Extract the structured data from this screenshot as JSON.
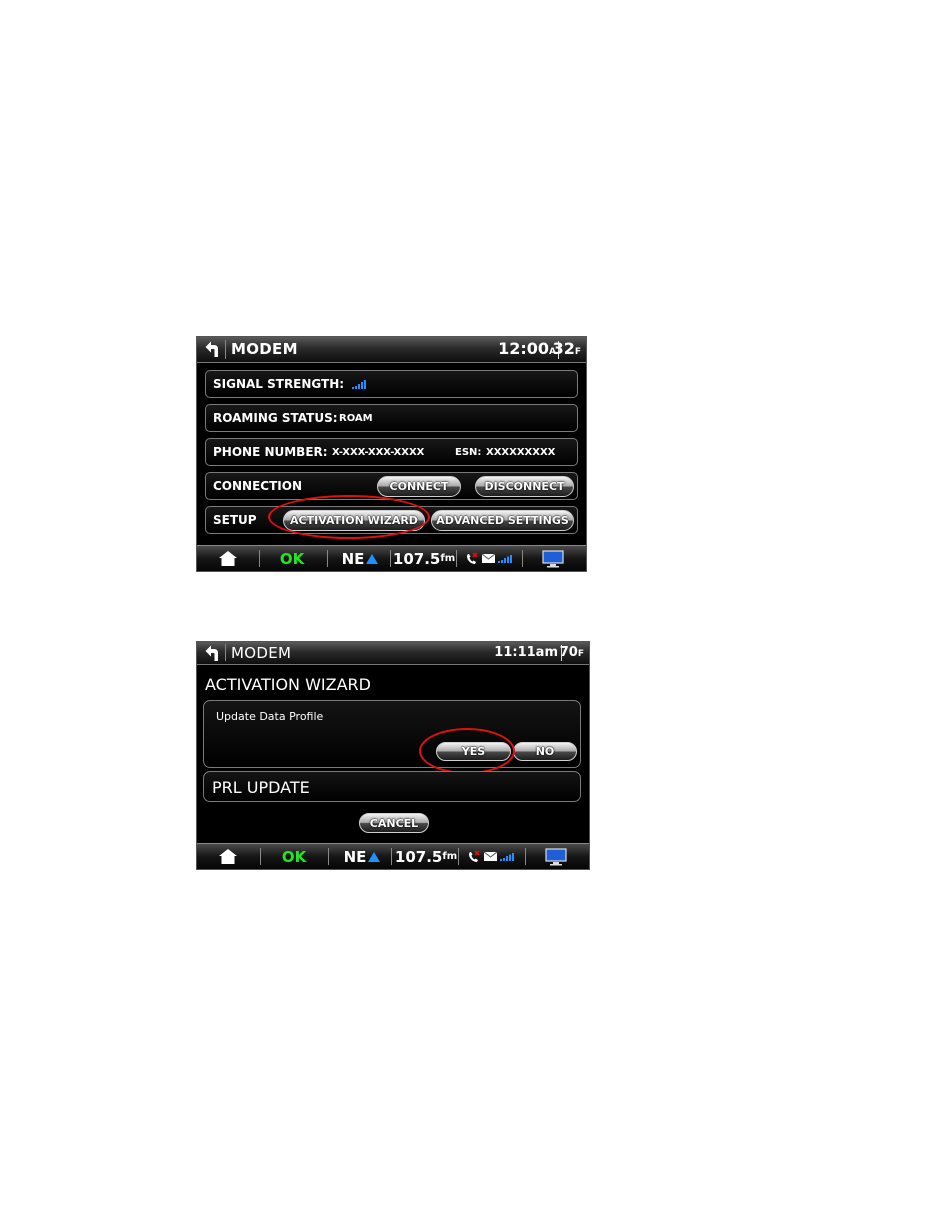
{
  "screen1": {
    "title": "MODEM",
    "clock": {
      "time": "12:00",
      "suffix": "A"
    },
    "temp": {
      "value": "32",
      "unit": "F"
    },
    "rows": {
      "signal_label": "SIGNAL STRENGTH:",
      "roaming_label": "ROAMING STATUS:",
      "roaming_value": "ROAM",
      "phone_label": "PHONE NUMBER:",
      "phone_value": "X-XXX-XXX-XXXX",
      "esn_label": "ESN:",
      "esn_value": "XXXXXXXXX",
      "connection_label": "CONNECTION",
      "connect_button": "CONNECT",
      "disconnect_button": "DISCONNECT",
      "setup_label": "SETUP",
      "activation_button": "ACTIVATION WIZARD",
      "advanced_button": "ADVANCED SETTINGS"
    }
  },
  "screen2": {
    "title": "MODEM",
    "clock": {
      "time": "11:11am"
    },
    "temp": {
      "value": "70",
      "unit": "F"
    },
    "wizard_title": "ACTIVATION WIZARD",
    "update_label": "Update Data Profile",
    "yes_button": "YES",
    "no_button": "NO",
    "prl_label": "PRL UPDATE",
    "cancel_button": "CANCEL"
  },
  "statusbar": {
    "status": "OK",
    "direction": "NE",
    "frequency": "107.5",
    "band": "fm"
  },
  "icons": [
    "back-arrow-icon",
    "signal-bars-icon",
    "home-icon",
    "north-arrow-icon",
    "missed-call-icon",
    "envelope-icon",
    "monitor-icon"
  ],
  "colors": {
    "ok_green": "#22e622",
    "signal_blue": "#1e90ff",
    "highlight_red": "#e01010"
  }
}
